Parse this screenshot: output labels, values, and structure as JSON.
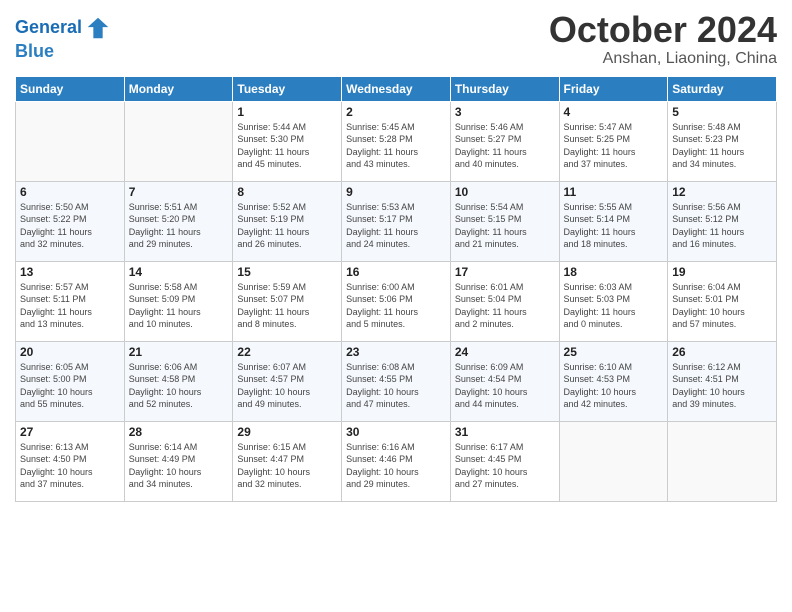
{
  "header": {
    "logo_line1": "General",
    "logo_line2": "Blue",
    "month": "October 2024",
    "location": "Anshan, Liaoning, China"
  },
  "weekdays": [
    "Sunday",
    "Monday",
    "Tuesday",
    "Wednesday",
    "Thursday",
    "Friday",
    "Saturday"
  ],
  "weeks": [
    [
      {
        "day": "",
        "info": ""
      },
      {
        "day": "",
        "info": ""
      },
      {
        "day": "1",
        "info": "Sunrise: 5:44 AM\nSunset: 5:30 PM\nDaylight: 11 hours\nand 45 minutes."
      },
      {
        "day": "2",
        "info": "Sunrise: 5:45 AM\nSunset: 5:28 PM\nDaylight: 11 hours\nand 43 minutes."
      },
      {
        "day": "3",
        "info": "Sunrise: 5:46 AM\nSunset: 5:27 PM\nDaylight: 11 hours\nand 40 minutes."
      },
      {
        "day": "4",
        "info": "Sunrise: 5:47 AM\nSunset: 5:25 PM\nDaylight: 11 hours\nand 37 minutes."
      },
      {
        "day": "5",
        "info": "Sunrise: 5:48 AM\nSunset: 5:23 PM\nDaylight: 11 hours\nand 34 minutes."
      }
    ],
    [
      {
        "day": "6",
        "info": "Sunrise: 5:50 AM\nSunset: 5:22 PM\nDaylight: 11 hours\nand 32 minutes."
      },
      {
        "day": "7",
        "info": "Sunrise: 5:51 AM\nSunset: 5:20 PM\nDaylight: 11 hours\nand 29 minutes."
      },
      {
        "day": "8",
        "info": "Sunrise: 5:52 AM\nSunset: 5:19 PM\nDaylight: 11 hours\nand 26 minutes."
      },
      {
        "day": "9",
        "info": "Sunrise: 5:53 AM\nSunset: 5:17 PM\nDaylight: 11 hours\nand 24 minutes."
      },
      {
        "day": "10",
        "info": "Sunrise: 5:54 AM\nSunset: 5:15 PM\nDaylight: 11 hours\nand 21 minutes."
      },
      {
        "day": "11",
        "info": "Sunrise: 5:55 AM\nSunset: 5:14 PM\nDaylight: 11 hours\nand 18 minutes."
      },
      {
        "day": "12",
        "info": "Sunrise: 5:56 AM\nSunset: 5:12 PM\nDaylight: 11 hours\nand 16 minutes."
      }
    ],
    [
      {
        "day": "13",
        "info": "Sunrise: 5:57 AM\nSunset: 5:11 PM\nDaylight: 11 hours\nand 13 minutes."
      },
      {
        "day": "14",
        "info": "Sunrise: 5:58 AM\nSunset: 5:09 PM\nDaylight: 11 hours\nand 10 minutes."
      },
      {
        "day": "15",
        "info": "Sunrise: 5:59 AM\nSunset: 5:07 PM\nDaylight: 11 hours\nand 8 minutes."
      },
      {
        "day": "16",
        "info": "Sunrise: 6:00 AM\nSunset: 5:06 PM\nDaylight: 11 hours\nand 5 minutes."
      },
      {
        "day": "17",
        "info": "Sunrise: 6:01 AM\nSunset: 5:04 PM\nDaylight: 11 hours\nand 2 minutes."
      },
      {
        "day": "18",
        "info": "Sunrise: 6:03 AM\nSunset: 5:03 PM\nDaylight: 11 hours\nand 0 minutes."
      },
      {
        "day": "19",
        "info": "Sunrise: 6:04 AM\nSunset: 5:01 PM\nDaylight: 10 hours\nand 57 minutes."
      }
    ],
    [
      {
        "day": "20",
        "info": "Sunrise: 6:05 AM\nSunset: 5:00 PM\nDaylight: 10 hours\nand 55 minutes."
      },
      {
        "day": "21",
        "info": "Sunrise: 6:06 AM\nSunset: 4:58 PM\nDaylight: 10 hours\nand 52 minutes."
      },
      {
        "day": "22",
        "info": "Sunrise: 6:07 AM\nSunset: 4:57 PM\nDaylight: 10 hours\nand 49 minutes."
      },
      {
        "day": "23",
        "info": "Sunrise: 6:08 AM\nSunset: 4:55 PM\nDaylight: 10 hours\nand 47 minutes."
      },
      {
        "day": "24",
        "info": "Sunrise: 6:09 AM\nSunset: 4:54 PM\nDaylight: 10 hours\nand 44 minutes."
      },
      {
        "day": "25",
        "info": "Sunrise: 6:10 AM\nSunset: 4:53 PM\nDaylight: 10 hours\nand 42 minutes."
      },
      {
        "day": "26",
        "info": "Sunrise: 6:12 AM\nSunset: 4:51 PM\nDaylight: 10 hours\nand 39 minutes."
      }
    ],
    [
      {
        "day": "27",
        "info": "Sunrise: 6:13 AM\nSunset: 4:50 PM\nDaylight: 10 hours\nand 37 minutes."
      },
      {
        "day": "28",
        "info": "Sunrise: 6:14 AM\nSunset: 4:49 PM\nDaylight: 10 hours\nand 34 minutes."
      },
      {
        "day": "29",
        "info": "Sunrise: 6:15 AM\nSunset: 4:47 PM\nDaylight: 10 hours\nand 32 minutes."
      },
      {
        "day": "30",
        "info": "Sunrise: 6:16 AM\nSunset: 4:46 PM\nDaylight: 10 hours\nand 29 minutes."
      },
      {
        "day": "31",
        "info": "Sunrise: 6:17 AM\nSunset: 4:45 PM\nDaylight: 10 hours\nand 27 minutes."
      },
      {
        "day": "",
        "info": ""
      },
      {
        "day": "",
        "info": ""
      }
    ]
  ]
}
